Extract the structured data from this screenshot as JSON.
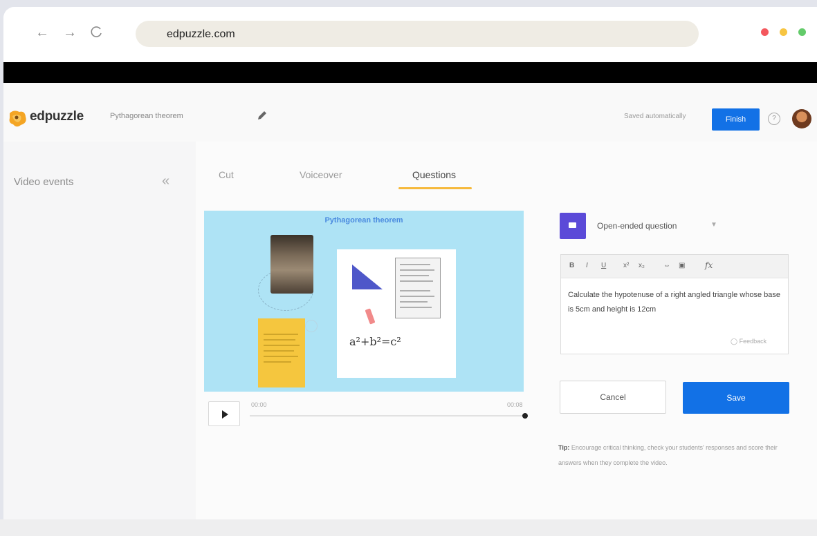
{
  "browser": {
    "url": "edpuzzle.com",
    "back_icon": "arrow-left-icon",
    "forward_icon": "arrow-right-icon",
    "reload_icon": "reload-icon",
    "dots": [
      "#f4575d",
      "#f7c542",
      "#63cb6a"
    ]
  },
  "header": {
    "logo_text": "edpuzzle",
    "video_title": "Pythagorean theorem",
    "saved_status": "Saved automatically",
    "finish_label": "Finish",
    "help_icon": "question-circle-icon",
    "accent": "#1271e6"
  },
  "sidebar": {
    "title": "Video events",
    "collapse_icon": "chevrons-left-icon"
  },
  "tabs": [
    {
      "label": "Cut",
      "active": false
    },
    {
      "label": "Voiceover",
      "active": false
    },
    {
      "label": "Questions",
      "active": true
    }
  ],
  "video": {
    "slide_title": "Pythagorean theorem",
    "formula": "a²+b²=c²",
    "time_start": "00:00",
    "time_end": "00:08"
  },
  "question": {
    "type_label": "Open-ended question",
    "text": "Calculate the hypotenuse of a right angled triangle whose base is 5cm and height is 12cm",
    "toolbar": [
      "B",
      "I",
      "U",
      "x²",
      "x₂",
      "⇔",
      "▣",
      "fx"
    ],
    "feedback_label": "Feedback",
    "cancel_label": "Cancel",
    "save_label": "Save"
  },
  "tip": {
    "prefix": "Tip:",
    "text": "Encourage critical thinking, check your students' responses and score their answers when they complete the video."
  }
}
